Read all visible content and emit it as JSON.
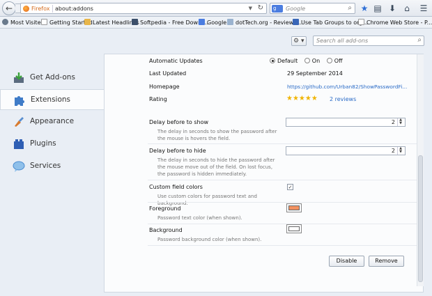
{
  "nav": {
    "back_glyph": "←",
    "identity": "Firefox",
    "url": "about:addons",
    "search_engine": "g",
    "search_placeholder": "Google"
  },
  "bookmarks": [
    {
      "label": "Most Visited",
      "icon": "gear-icon",
      "color": "#6a7a8c"
    },
    {
      "label": "Getting Started",
      "icon": "page-icon",
      "color": "#d9dde2"
    },
    {
      "label": "Latest Headlines",
      "icon": "rss-folder-icon",
      "color": "#e8b64a"
    },
    {
      "label": "Softpedia - Free Downl...",
      "icon": "softpedia-icon",
      "color": "#3c4f6a"
    },
    {
      "label": "Google",
      "icon": "google-icon",
      "color": "#4b7de0"
    },
    {
      "label": "dotTech.org - Reviews...",
      "icon": "dottech-icon",
      "color": "#9bb3cf"
    },
    {
      "label": "Use Tab Groups to org...",
      "icon": "page-icon",
      "color": "#3a67b8"
    },
    {
      "label": "Chrome Web Store - P...",
      "icon": "page-icon",
      "color": "#e5e8ec"
    }
  ],
  "sidebar": {
    "items": [
      {
        "label": "Get Add-ons",
        "icon": "get-addons-icon"
      },
      {
        "label": "Extensions",
        "icon": "extensions-puzzle-icon"
      },
      {
        "label": "Appearance",
        "icon": "appearance-brush-icon"
      },
      {
        "label": "Plugins",
        "icon": "plugins-brick-icon"
      },
      {
        "label": "Services",
        "icon": "services-bubble-icon"
      }
    ]
  },
  "tools": {
    "gear": "⚙",
    "search_placeholder": "Search all add-ons"
  },
  "details": {
    "auto_updates_label": "Automatic Updates",
    "auto_updates_options": [
      "Default",
      "On",
      "Off"
    ],
    "auto_updates_selected": "Default",
    "last_updated_label": "Last Updated",
    "last_updated_value": "29 September 2014",
    "homepage_label": "Homepage",
    "homepage_value": "https://github.com/Urban82/ShowPasswordFi...",
    "rating_label": "Rating",
    "rating_stars": "★★★★★",
    "rating_reviews": "2 reviews"
  },
  "prefs": {
    "delay_show_label": "Delay before to show",
    "delay_show_desc": "The delay in seconds to show the password after the mouse is hovers the field.",
    "delay_show_value": "2",
    "delay_hide_label": "Delay before to hide",
    "delay_hide_desc": "The delay in seconds to hide the password after the mouse move out of the field. On lost focus, the password is hidden immediately.",
    "delay_hide_value": "2",
    "custom_colors_label": "Custom field colors",
    "custom_colors_desc": "Use custom colors for password text and background.",
    "custom_colors_checked": "✓",
    "foreground_label": "Foreground",
    "foreground_desc": "Password text color (when shown).",
    "foreground_color": "#f29160",
    "background_label": "Background",
    "background_desc": "Password background color (when shown).",
    "background_color": "#ffffff"
  },
  "actions": {
    "disable": "Disable",
    "remove": "Remove"
  }
}
